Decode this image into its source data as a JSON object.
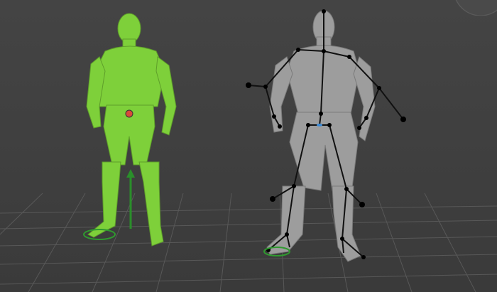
{
  "viewport": {
    "background": "#404040",
    "grid_color": "#555555"
  },
  "figures": [
    {
      "name": "selected-character",
      "state": "selected",
      "color": "#7fd13a"
    },
    {
      "name": "rigged-character",
      "state": "skeleton-visible",
      "color": "#9a9a9a"
    }
  ],
  "skeleton": {
    "bone_color": "#111111",
    "joint_color": "#000000"
  },
  "manipulator": {
    "axis": "y",
    "color": "#2a8f2a",
    "icon": "move-arrow-icon"
  },
  "view_cube": {
    "icon": "view-cube-icon",
    "indicator_color": "#39b54a"
  }
}
